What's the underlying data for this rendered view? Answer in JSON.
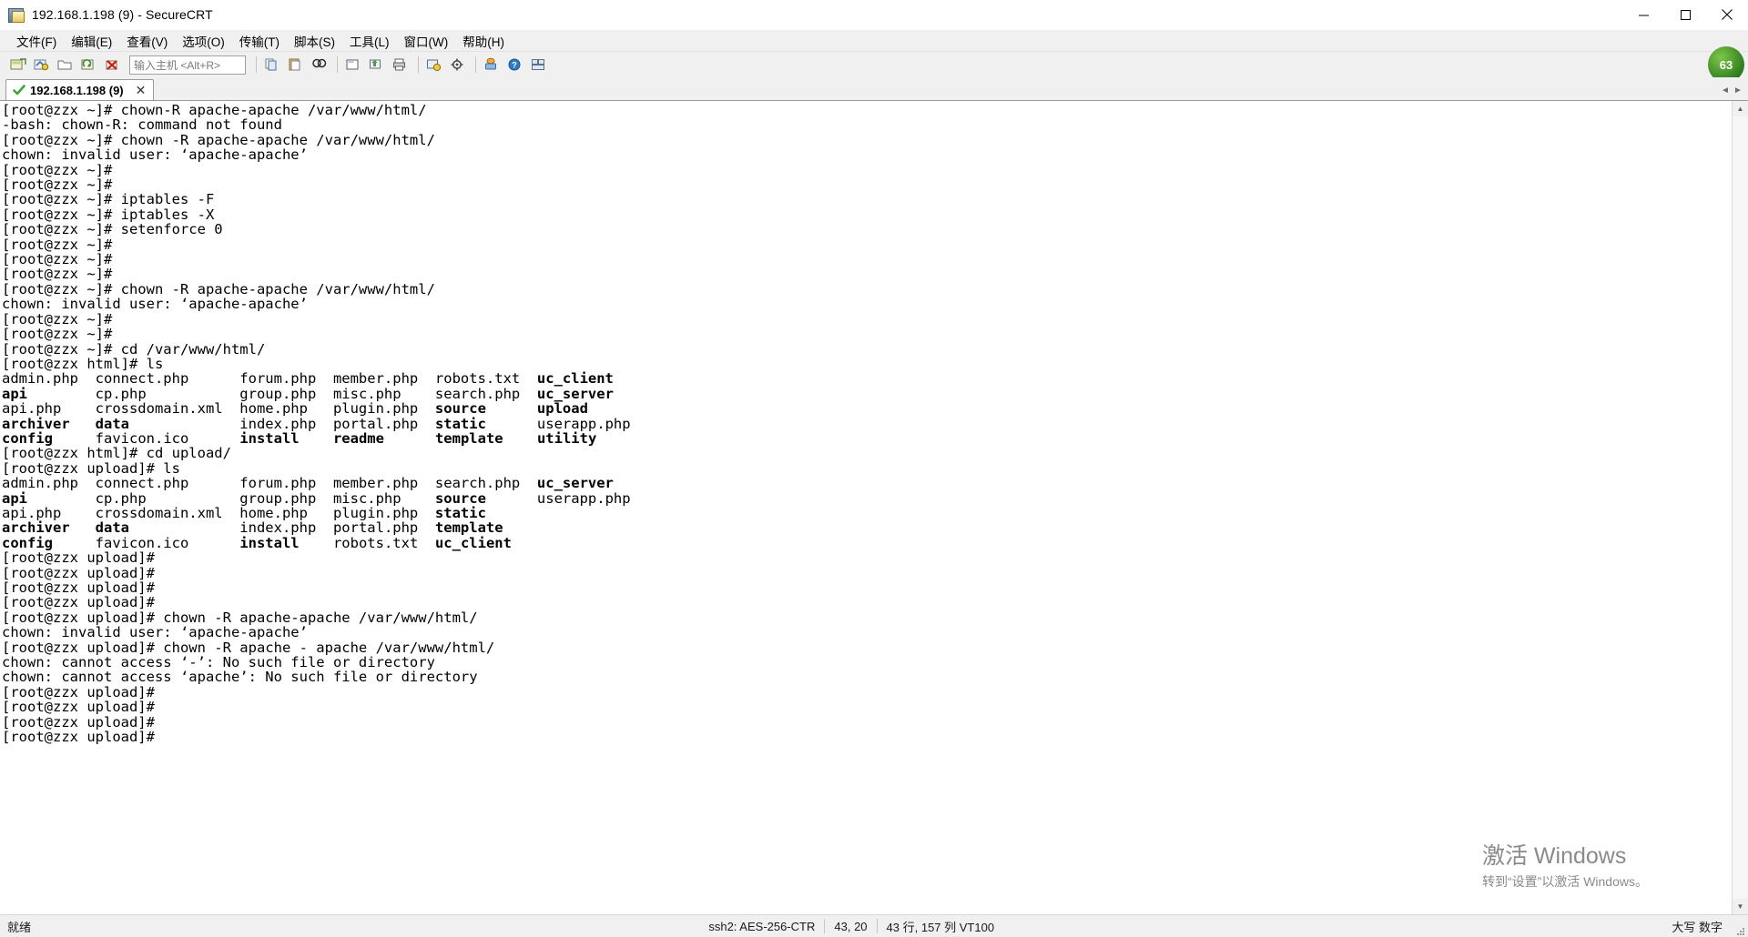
{
  "window": {
    "title": "192.168.1.198 (9) - SecureCRT",
    "icon_name": "securecrt-app-icon",
    "minimize_label": "–",
    "maximize_label": "☐",
    "close_label": "✕"
  },
  "menubar": {
    "items": [
      {
        "label": "文件(F)",
        "name": "menu-file"
      },
      {
        "label": "编辑(E)",
        "name": "menu-edit"
      },
      {
        "label": "查看(V)",
        "name": "menu-view"
      },
      {
        "label": "选项(O)",
        "name": "menu-options"
      },
      {
        "label": "传输(T)",
        "name": "menu-transfer"
      },
      {
        "label": "脚本(S)",
        "name": "menu-script"
      },
      {
        "label": "工具(L)",
        "name": "menu-tools"
      },
      {
        "label": "窗口(W)",
        "name": "menu-window"
      },
      {
        "label": "帮助(H)",
        "name": "menu-help"
      }
    ]
  },
  "toolbar": {
    "host_entry_placeholder": "输入主机 <Alt+R>",
    "host_entry_value": "",
    "logo_text": "63",
    "buttons": [
      {
        "name": "new-session-icon"
      },
      {
        "name": "quick-connect-icon"
      },
      {
        "name": "open-session-folder-icon"
      },
      {
        "name": "reconnect-icon"
      },
      {
        "name": "disconnect-icon"
      },
      {
        "name": "copy-icon"
      },
      {
        "name": "paste-icon"
      },
      {
        "name": "find-icon"
      },
      {
        "name": "log-session-icon"
      },
      {
        "name": "transfer-window-icon"
      },
      {
        "name": "print-icon"
      },
      {
        "name": "session-options-icon"
      },
      {
        "name": "global-options-icon"
      },
      {
        "name": "chat-window-icon"
      },
      {
        "name": "help-icon"
      },
      {
        "name": "tile-windows-icon"
      }
    ]
  },
  "tabbar": {
    "tabs": [
      {
        "label": "192.168.1.198 (9)",
        "status_icon": "connected-check-icon",
        "close_icon": "close-icon",
        "active": true
      }
    ],
    "scroll_left_label": "◄",
    "scroll_right_label": "►"
  },
  "terminal": {
    "lines": [
      {
        "text": "[root@zzx ~]# chown-R apache-apache /var/www/html/"
      },
      {
        "text": "-bash: chown-R: command not found"
      },
      {
        "text": "[root@zzx ~]# chown -R apache-apache /var/www/html/"
      },
      {
        "text": "chown: invalid user: ‘apache-apache’"
      },
      {
        "text": "[root@zzx ~]#"
      },
      {
        "text": "[root@zzx ~]#"
      },
      {
        "text": "[root@zzx ~]# iptables -F"
      },
      {
        "text": "[root@zzx ~]# iptables -X"
      },
      {
        "text": "[root@zzx ~]# setenforce 0"
      },
      {
        "text": "[root@zzx ~]#"
      },
      {
        "text": "[root@zzx ~]#"
      },
      {
        "text": "[root@zzx ~]#"
      },
      {
        "text": "[root@zzx ~]# chown -R apache-apache /var/www/html/"
      },
      {
        "text": "chown: invalid user: ‘apache-apache’"
      },
      {
        "text": "[root@zzx ~]#"
      },
      {
        "text": "[root@zzx ~]#"
      },
      {
        "text": "[root@zzx ~]# cd /var/www/html/"
      },
      {
        "text": "[root@zzx html]# ls"
      },
      {
        "segments": [
          {
            "t": "admin.php  connect.php      forum.php  member.php  robots.txt  ",
            "bold": false
          },
          {
            "t": "uc_client",
            "bold": true
          }
        ]
      },
      {
        "segments": [
          {
            "t": "api",
            "bold": true
          },
          {
            "t": "        cp.php           group.php  misc.php    search.php  ",
            "bold": false
          },
          {
            "t": "uc_server",
            "bold": true
          }
        ]
      },
      {
        "segments": [
          {
            "t": "api.php    crossdomain.xml  home.php   plugin.php  ",
            "bold": false
          },
          {
            "t": "source",
            "bold": true
          },
          {
            "t": "      ",
            "bold": false
          },
          {
            "t": "upload",
            "bold": true
          }
        ]
      },
      {
        "segments": [
          {
            "t": "archiver",
            "bold": true
          },
          {
            "t": "   ",
            "bold": false
          },
          {
            "t": "data",
            "bold": true
          },
          {
            "t": "             index.php  portal.php  ",
            "bold": false
          },
          {
            "t": "static",
            "bold": true
          },
          {
            "t": "      userapp.php",
            "bold": false
          }
        ]
      },
      {
        "segments": [
          {
            "t": "config",
            "bold": true
          },
          {
            "t": "     favicon.ico      ",
            "bold": false
          },
          {
            "t": "install",
            "bold": true
          },
          {
            "t": "    ",
            "bold": false
          },
          {
            "t": "readme",
            "bold": true
          },
          {
            "t": "      ",
            "bold": false
          },
          {
            "t": "template",
            "bold": true
          },
          {
            "t": "    ",
            "bold": false
          },
          {
            "t": "utility",
            "bold": true
          }
        ]
      },
      {
        "text": "[root@zzx html]# cd upload/"
      },
      {
        "text": "[root@zzx upload]# ls"
      },
      {
        "segments": [
          {
            "t": "admin.php  connect.php      forum.php  member.php  search.php  ",
            "bold": false
          },
          {
            "t": "uc_server",
            "bold": true
          }
        ]
      },
      {
        "segments": [
          {
            "t": "api",
            "bold": true
          },
          {
            "t": "        cp.php           group.php  misc.php    ",
            "bold": false
          },
          {
            "t": "source",
            "bold": true
          },
          {
            "t": "      userapp.php",
            "bold": false
          }
        ]
      },
      {
        "segments": [
          {
            "t": "api.php    crossdomain.xml  home.php   plugin.php  ",
            "bold": false
          },
          {
            "t": "static",
            "bold": true
          }
        ]
      },
      {
        "segments": [
          {
            "t": "archiver",
            "bold": true
          },
          {
            "t": "   ",
            "bold": false
          },
          {
            "t": "data",
            "bold": true
          },
          {
            "t": "             index.php  portal.php  ",
            "bold": false
          },
          {
            "t": "template",
            "bold": true
          }
        ]
      },
      {
        "segments": [
          {
            "t": "config",
            "bold": true
          },
          {
            "t": "     favicon.ico      ",
            "bold": false
          },
          {
            "t": "install",
            "bold": true
          },
          {
            "t": "    robots.txt  ",
            "bold": false
          },
          {
            "t": "uc_client",
            "bold": true
          }
        ]
      },
      {
        "text": "[root@zzx upload]#"
      },
      {
        "text": "[root@zzx upload]#"
      },
      {
        "text": "[root@zzx upload]#"
      },
      {
        "text": "[root@zzx upload]#"
      },
      {
        "text": "[root@zzx upload]# chown -R apache-apache /var/www/html/"
      },
      {
        "text": "chown: invalid user: ‘apache-apache’"
      },
      {
        "text": "[root@zzx upload]# chown -R apache - apache /var/www/html/"
      },
      {
        "text": "chown: cannot access ‘-’: No such file or directory"
      },
      {
        "text": "chown: cannot access ‘apache’: No such file or directory"
      },
      {
        "text": "[root@zzx upload]#"
      },
      {
        "text": "[root@zzx upload]#"
      },
      {
        "text": "[root@zzx upload]#"
      },
      {
        "text": "[root@zzx upload]#"
      }
    ]
  },
  "watermark": {
    "title": "激活 Windows",
    "subtitle": "转到“设置”以激活 Windows。"
  },
  "statusbar": {
    "ready": "就绪",
    "encryption": "ssh2: AES-256-CTR",
    "cursor": "43, 20",
    "dimensions": "43 行, 157 列 VT100",
    "keys": "大写  数字"
  }
}
